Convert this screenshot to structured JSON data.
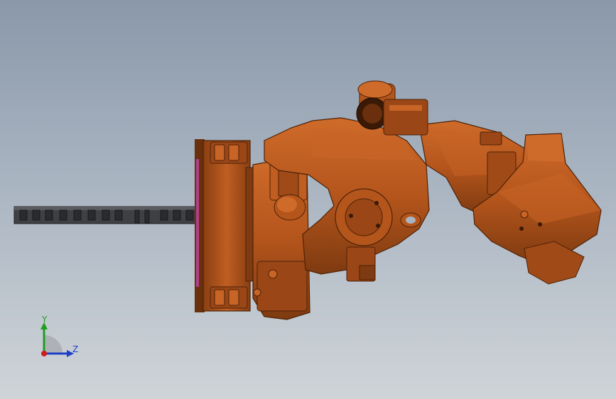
{
  "viewport": {
    "background_top": "#8a98a9",
    "background_bottom": "#cfd4d8"
  },
  "model": {
    "body_color": "#b4551c",
    "shadow_color": "#6a2f0c",
    "highlight_color": "#cf6b2a",
    "tool_color": "#3f4043"
  },
  "triad": {
    "y_label": "Y",
    "z_label": "Z",
    "y_color": "#1f9e1f",
    "z_color": "#1f3fc8",
    "origin_color": "#d01a1a"
  }
}
